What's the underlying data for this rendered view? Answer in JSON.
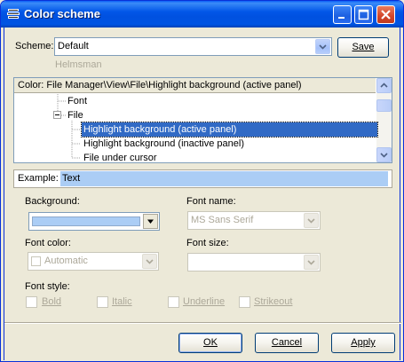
{
  "window": {
    "title": "Color scheme"
  },
  "scheme": {
    "label": "Scheme:",
    "value": "Default",
    "hint": "Helmsman",
    "save_label": "Save"
  },
  "tree": {
    "header": "Color: File Manager\\View\\File\\Highlight background (active panel)",
    "items": [
      {
        "label": "Font",
        "expander": ""
      },
      {
        "label": "File",
        "expander": "−"
      },
      {
        "label": "Highlight background (active panel)",
        "selected": true
      },
      {
        "label": "Highlight background (inactive panel)"
      },
      {
        "label": "File under cursor"
      }
    ]
  },
  "example": {
    "label": "Example:",
    "text": "Text"
  },
  "background": {
    "label": "Background:",
    "color": "#abcdf5"
  },
  "font_name": {
    "label": "Font name:",
    "value": "MS Sans Serif"
  },
  "font_color": {
    "label": "Font color:",
    "value": "Automatic"
  },
  "font_size": {
    "label": "Font size:",
    "value": ""
  },
  "font_style": {
    "label": "Font style:",
    "options": [
      "Bold",
      "Italic",
      "Underline",
      "Strikeout"
    ]
  },
  "footer": {
    "ok": "OK",
    "cancel": "Cancel",
    "apply": "Apply"
  },
  "colors": {
    "titlebar": "#0054e3",
    "selection": "#316ac5",
    "highlight": "#abcdf5",
    "dialog": "#ece9d8"
  }
}
